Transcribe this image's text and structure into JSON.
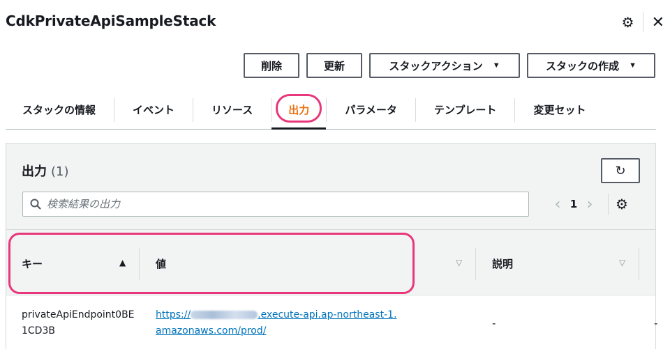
{
  "header": {
    "stack_title": "CdkPrivateApiSampleStack",
    "settings_icon": "⚙",
    "close_icon": "✕"
  },
  "actions": {
    "delete_label": "削除",
    "update_label": "更新",
    "stack_actions_label": "スタックアクション",
    "create_stack_label": "スタックの作成",
    "dropdown_caret": "▼"
  },
  "tabs": [
    {
      "label": "スタックの情報",
      "active": false
    },
    {
      "label": "イベント",
      "active": false
    },
    {
      "label": "リソース",
      "active": false
    },
    {
      "label": "出力",
      "active": true
    },
    {
      "label": "パラメータ",
      "active": false
    },
    {
      "label": "テンプレート",
      "active": false
    },
    {
      "label": "変更セット",
      "active": false
    }
  ],
  "outputs_panel": {
    "title": "出力",
    "count": "(1)",
    "refresh_icon": "↻",
    "search_placeholder": "検索結果の出力",
    "search_icon": "🔍",
    "pagination": {
      "prev_icon": "‹",
      "current_page": "1",
      "next_icon": "›",
      "settings_icon": "⚙"
    },
    "table": {
      "columns": [
        {
          "label": "キー",
          "sort_icon": "▲"
        },
        {
          "label": "値",
          "sort_icon": "▽"
        },
        {
          "label": "説明",
          "sort_icon": "▽"
        }
      ],
      "rows": [
        {
          "key": "privateApiEndpoint0BE1CD3B",
          "value_prefix": "https://",
          "value_suffix": ".execute-api.ap-northeast-1.amazonaws.com/prod/",
          "description": "-",
          "extra": "-"
        }
      ]
    }
  },
  "colors": {
    "accent_active_tab": "#ec7211",
    "highlight_ring": "#e8377a",
    "link": "#0073bb",
    "text": "#16191f"
  }
}
